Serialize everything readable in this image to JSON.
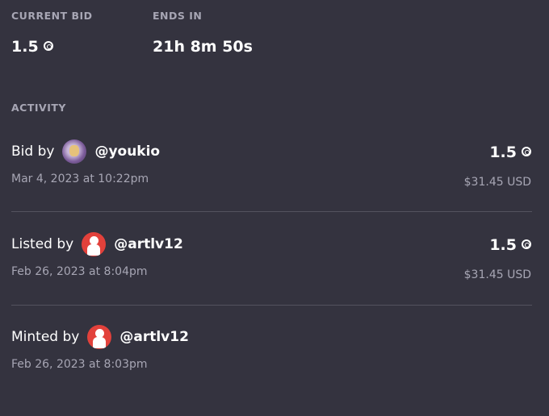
{
  "auction": {
    "current_bid_label": "CURRENT BID",
    "current_bid_value": "1.5",
    "ends_in_label": "ENDS IN",
    "ends_in_value": "21h 8m 50s"
  },
  "activity": {
    "heading": "ACTIVITY",
    "items": [
      {
        "action": "Bid by",
        "handle": "@youkio",
        "avatar": "youkio-avatar",
        "date": "Mar 4, 2023 at 10:22pm",
        "price": "1.5",
        "usd": "$31.45 USD"
      },
      {
        "action": "Listed by",
        "handle": "@artlv12",
        "avatar": "artlv12-avatar",
        "date": "Feb 26, 2023 at 8:04pm",
        "price": "1.5",
        "usd": "$31.45 USD"
      },
      {
        "action": "Minted by",
        "handle": "@artlv12",
        "avatar": "artlv12-avatar",
        "date": "Feb 26, 2023 at 8:03pm"
      }
    ]
  },
  "icons": {
    "currency": "tezos-coin-icon"
  },
  "colors": {
    "background": "#34333f",
    "muted": "#a7a6b4",
    "divider": "#54535f"
  }
}
